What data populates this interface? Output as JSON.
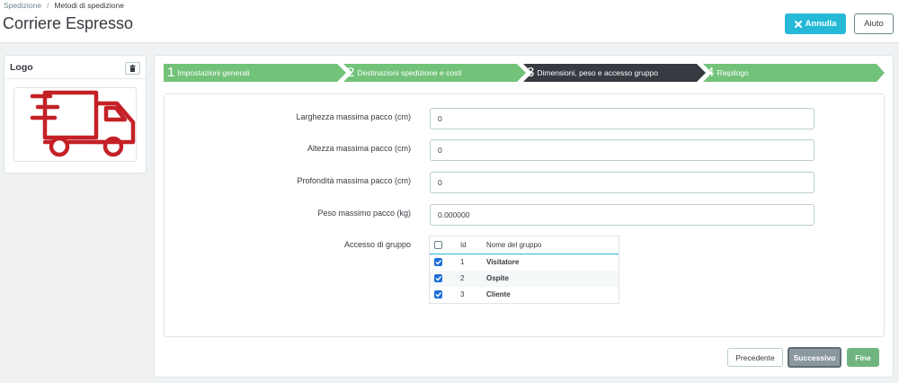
{
  "header": {
    "breadcrumb": [
      "Spedizione",
      "Metodi di spedizione"
    ],
    "breadcrumb_sep": "/",
    "title": "Corriere Espresso",
    "cancel_label": "Annulla",
    "help_label": "Aiuto",
    "accent_color": "#25b9d7"
  },
  "logo_panel": {
    "title": "Logo",
    "delete_icon": "trash-icon",
    "logo_icon": "delivery-truck-icon",
    "logo_color": "#c42127"
  },
  "wizard": {
    "steps": [
      {
        "number": "1",
        "label": "Impostazioni generali",
        "state": "done",
        "color": "#72c279"
      },
      {
        "number": "2",
        "label": "Destinazioni spedizione e costi",
        "state": "done",
        "color": "#72c279"
      },
      {
        "number": "3",
        "label": "Dimensioni, peso e accesso gruppo",
        "state": "active",
        "color": "#363a41"
      },
      {
        "number": "4",
        "label": "Riepilogo",
        "state": "todo",
        "color": "#72c279"
      }
    ]
  },
  "form": {
    "fields": [
      {
        "label": "Larghezza massima pacco (cm)",
        "value": "0"
      },
      {
        "label": "Altezza massima pacco (cm)",
        "value": "0"
      },
      {
        "label": "Profondità massima pacco (cm)",
        "value": "0"
      },
      {
        "label": "Peso massimo pacco (kg)",
        "value": "0.000000"
      }
    ],
    "group_access_label": "Accesso di gruppo",
    "group_table": {
      "columns": [
        "Id",
        "Nome del gruppo"
      ],
      "select_all_checked": false,
      "rows": [
        {
          "id": "1",
          "name": "Visitatore",
          "checked": true
        },
        {
          "id": "2",
          "name": "Ospite",
          "checked": true
        },
        {
          "id": "3",
          "name": "Cliente",
          "checked": true
        }
      ]
    }
  },
  "footer": {
    "prev_label": "Precedente",
    "next_label": "Successivo",
    "finish_label": "Fine"
  }
}
